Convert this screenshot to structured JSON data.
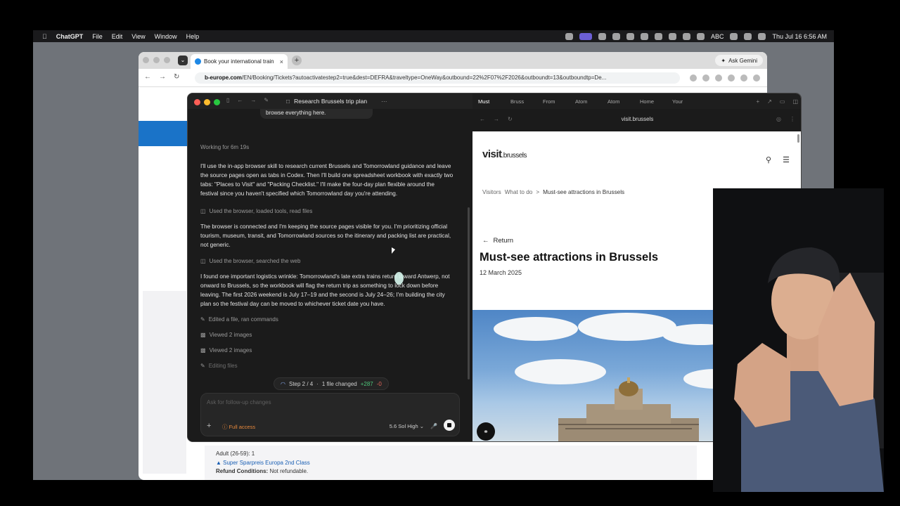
{
  "menubar": {
    "app": "ChatGPT",
    "items": [
      "File",
      "Edit",
      "View",
      "Window",
      "Help"
    ],
    "status_text": "ABC",
    "datetime": "Thu Jul 16  6:56 AM"
  },
  "chrome": {
    "tab_title": "Book your international train",
    "ask_label": "Ask Gemini",
    "url_host": "b-europe.com",
    "url_rest": "/EN/Booking/Tickets?autoactivatestep2=true&dest=DEFRA&traveltype=OneWay&outbound=22%2F07%2F2026&outboundt=13&outboundtp=De...",
    "booking": {
      "adult": "Adult (26-59): 1",
      "fare": "Super Sparpreis Europa 2nd Class",
      "refund_label": "Refund Conditions:",
      "refund_value": "Not refundable."
    }
  },
  "codex": {
    "title": "Research Brussels trip plan",
    "more": "···",
    "chat": {
      "bubble": "browse everything here.",
      "working": "Working for 6m 19s",
      "msg1": "I'll use the in-app browser skill to research current Brussels and Tomorrowland guidance and leave the source pages open as tabs in Codex. Then I'll build one spreadsheet workbook with exactly two tabs: \"Places to Visit\" and \"Packing Checklist.\" I'll make the four-day plan flexible around the festival since you haven't specified which Tomorrowland day you're attending.",
      "act1": "Used the browser, loaded tools, read files",
      "msg2": "The browser is connected and I'm keeping the source pages visible for you. I'm prioritizing official tourism, museum, transit, and Tomorrowland sources so the itinerary and packing list are practical, not generic.",
      "act2": "Used the browser, searched the web",
      "msg3": "I found one important logistics wrinkle: Tomorrowland's late extra trains return toward Antwerp, not onward to Brussels, so the workbook will flag the return trip as something to lock down before leaving. The first 2026 weekend is July 17–19 and the second is July 24–26; I'm building the city plan so the festival day can be moved to whichever ticket date you have.",
      "act3": "Edited a file, ran commands",
      "act4": "Viewed 2 images",
      "act5": "Viewed 2 images",
      "act6": "Editing files",
      "step": "Step 2 / 4",
      "changed": "1 file changed",
      "plus": "+287",
      "minus": "-0",
      "placeholder": "Ask for follow-up changes",
      "access": "Full access",
      "model": "5.6 Sol  High"
    },
    "browser": {
      "tabs": [
        "Must",
        "Bruss",
        "From",
        "Atom",
        "Atom",
        "Home",
        "Your"
      ],
      "host": "visit.brussels",
      "logo_main": "visit",
      "logo_sub": ".brussels",
      "crumbs": [
        "Visitors",
        "What to do",
        "Must-see attractions in Brussels"
      ],
      "sep": ">",
      "return": "Return",
      "heading": "Must-see attractions in Brussels",
      "date": "12 March 2025"
    }
  }
}
